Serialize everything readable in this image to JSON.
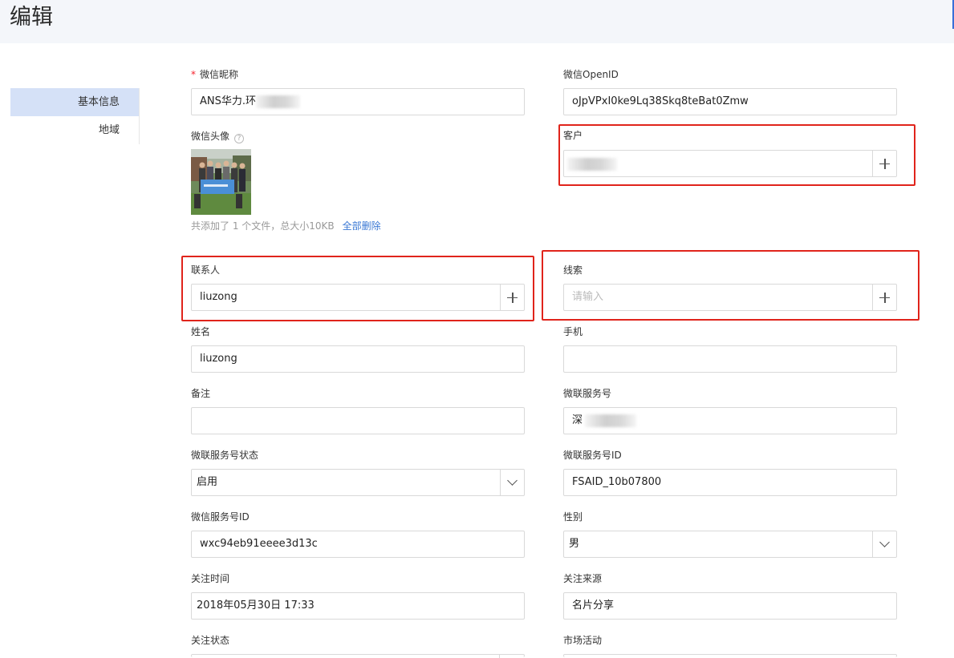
{
  "header": {
    "title": "编辑"
  },
  "sidebar": {
    "items": [
      {
        "label": "基本信息"
      },
      {
        "label": "地域"
      }
    ]
  },
  "form": {
    "wechat_nickname": {
      "label": "微信昵称",
      "required_mark": "*",
      "value": "ANS华力.环"
    },
    "wechat_openid": {
      "label": "微信OpenID",
      "value": "oJpVPxI0ke9Lq38Skq8teBat0Zmw"
    },
    "wechat_avatar": {
      "label": "微信头像",
      "help": "?",
      "file_summary": "共添加了 1 个文件，总大小10KB",
      "delete_all": "全部删除"
    },
    "customer": {
      "label": "客户",
      "value": ""
    },
    "contact": {
      "label": "联系人",
      "value": "liuzong"
    },
    "lead": {
      "label": "线索",
      "placeholder": "请输入"
    },
    "name": {
      "label": "姓名",
      "value": "liuzong"
    },
    "mobile": {
      "label": "手机",
      "value": ""
    },
    "remark": {
      "label": "备注",
      "value": ""
    },
    "service_account": {
      "label": "微联服务号",
      "value": "深"
    },
    "service_account_status": {
      "label": "微联服务号状态",
      "value": "启用"
    },
    "service_account_id": {
      "label": "微联服务号ID",
      "value": "FSAID_10b07800"
    },
    "wechat_service_id": {
      "label": "微信服务号ID",
      "value": "wxc94eb91eeee3d13c"
    },
    "gender": {
      "label": "性别",
      "value": "男"
    },
    "follow_time": {
      "label": "关注时间",
      "value": "2018年05月30日 17:33"
    },
    "follow_source": {
      "label": "关注来源",
      "value": "名片分享"
    },
    "follow_status": {
      "label": "关注状态"
    },
    "campaign": {
      "label": "市场活动"
    }
  },
  "colors": {
    "highlight": "#e0241b",
    "link": "#3a78d4",
    "nav_active": "#d5e1f7"
  }
}
